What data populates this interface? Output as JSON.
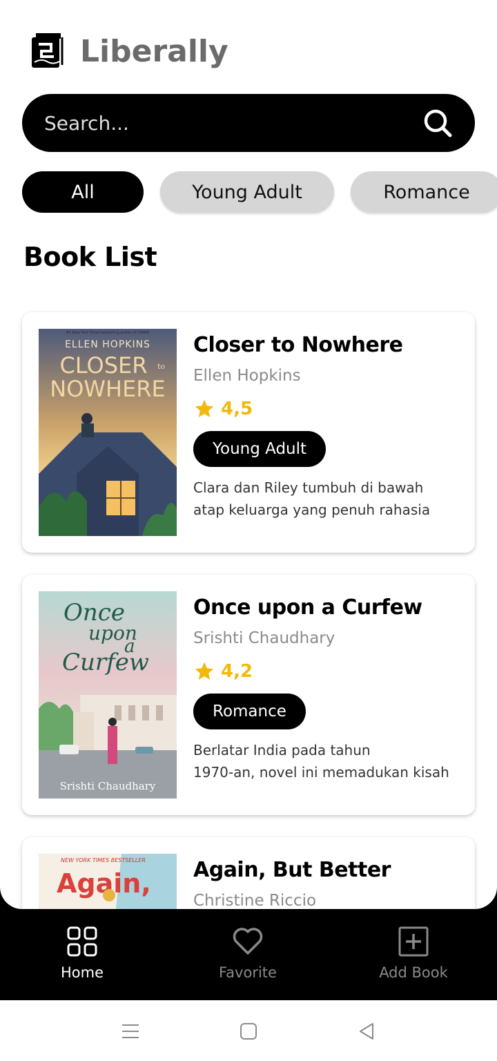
{
  "app": {
    "title": "Liberally",
    "logo_icon": "book-logo-icon"
  },
  "search": {
    "placeholder": "Search...",
    "icon": "search-icon"
  },
  "categories": [
    {
      "label": "All",
      "active": true
    },
    {
      "label": "Young Adult",
      "active": false
    },
    {
      "label": "Romance",
      "active": false
    }
  ],
  "section": {
    "title": "Book List"
  },
  "books": [
    {
      "title": "Closer to Nowhere",
      "author": "Ellen Hopkins",
      "rating": "4,5",
      "genre": "Young Adult",
      "desc_line1": "Clara dan Riley tumbuh di bawah",
      "desc_line2": "atap keluarga yang penuh rahasia",
      "cover": {
        "top_text": "#1 New York Times bestselling author of CRANK",
        "author": "ELLEN HOPKINS",
        "title_line1": "CLOSER",
        "title_small": "to",
        "title_line2": "NOWHERE"
      }
    },
    {
      "title": "Once upon a Curfew",
      "author": "Srishti Chaudhary",
      "rating": "4,2",
      "genre": "Romance",
      "desc_line1": "Berlatar India pada tahun",
      "desc_line2": "1970-an, novel ini memadukan kisah",
      "cover": {
        "title_line1": "Once",
        "title_line2": "upon",
        "title_line3": "a",
        "title_line4": "Curfew",
        "author": "Srishti Chaudhary"
      }
    },
    {
      "title": "Again, But Better",
      "author": "Christine Riccio",
      "cover": {
        "top_text": "NEW YORK TIMES BESTSELLER",
        "title": "Again,"
      }
    }
  ],
  "nav": {
    "home": {
      "label": "Home",
      "icon": "grid-icon"
    },
    "favorite": {
      "label": "Favorite",
      "icon": "heart-icon"
    },
    "add": {
      "label": "Add Book",
      "icon": "plus-square-icon"
    }
  },
  "colors": {
    "accent": "#000000",
    "star": "#f2b90c",
    "chip_inactive": "#d6d6d6",
    "title_gray": "#6b6b6b"
  }
}
